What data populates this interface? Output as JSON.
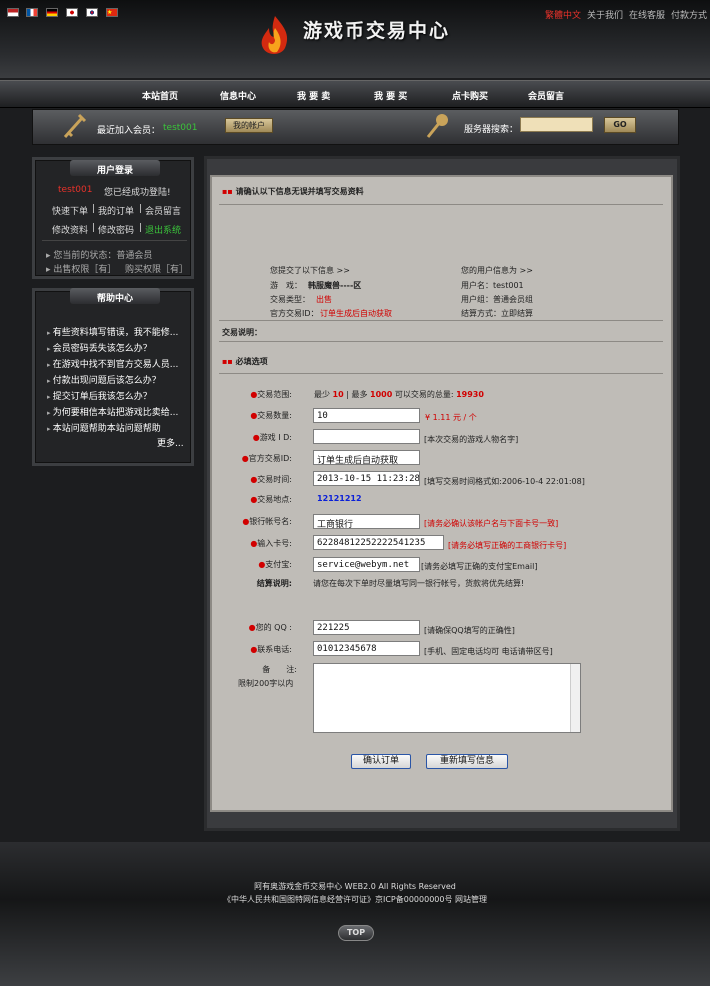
{
  "topbar": {
    "links": [
      "繁體中文",
      "关于我们",
      "在线客服",
      "付款方式"
    ],
    "title": "游戏币交易中心"
  },
  "nav": [
    "本站首页",
    "信息中心",
    "我 要 卖",
    "我 要 买",
    "点卡购买",
    "会员留言"
  ],
  "infobar": {
    "recent_label": "最近加入会员：",
    "recent_user": "test001",
    "account_btn": "我的帐户",
    "search_label": "服务器搜索：",
    "go_btn": "GO"
  },
  "login_panel": {
    "title": "用户登录",
    "username": "test001",
    "welcome": "您已经成功登陆!",
    "row1": [
      "快速下单",
      "我的订单",
      "会员留言"
    ],
    "row2": [
      "修改资料",
      "修改密码",
      "退出系统"
    ],
    "status": "您当前的状态：普通会员",
    "perm_sell": "出售权限［有］",
    "perm_buy": "购买权限［有］"
  },
  "help_panel": {
    "title": "帮助中心",
    "items": [
      "有些资料填写错误，我不能修...",
      "会员密码丢失该怎么办？",
      "在游戏中找不到官方交易人员...",
      "付款出现问题后该怎么办？",
      "提交订单后我该怎么办？",
      "为何要相信本站把游戏比卖给...",
      "本站问题帮助本站问题帮助"
    ],
    "more": "更多..."
  },
  "main": {
    "heading": "请确认以下信息无误并填写交易资料",
    "submitted_label": "您提交了以下信息 >>",
    "user_info_label": "您的用户信息为 >>",
    "game_label": "游　戏：",
    "game_value": "韩服魔兽----区",
    "trade_type_label": "交易类型：",
    "trade_type_value": "出售",
    "trade_id_label": "官方交易ID：",
    "trade_id_value": "订单生成后自动获取",
    "username_line": "用户名：test001",
    "group_line": "用户组：普通会员组",
    "settle_line": "结算方式：立即结算",
    "desc_label": "交易说明：",
    "required_label": "必填选项",
    "range_label": "交易范围:",
    "range_text": {
      "a": "最少",
      "min": "10",
      "b": "| 最多",
      "max": "1000",
      "c": "可以交易的总量:",
      "total": "19930"
    },
    "qty_label": "交易数量:",
    "qty_value": "10",
    "price": "¥ 1.11 元 / 个",
    "role_label": "游戏 I D:",
    "role_value": "",
    "role_hint": "[本次交易的游戏人物名字]",
    "off_id_label": "官方交易ID:",
    "off_id_value": "订单生成后自动获取",
    "time_label": "交易时间:",
    "time_value": "2013-10-15 11:23:28",
    "time_hint": "[填写交易时间格式如:2006-10-4 22:01:08]",
    "place_label": "交易地点:",
    "place_value": "12121212",
    "bank_label": "银行帐号名:",
    "bank_value": "工商银行",
    "bank_hint": "[请务必确认该帐户名与下面卡号一致]",
    "card_label": "输入卡号:",
    "card_value": "62284812252222541235",
    "card_hint": "[请务必填写正确的工商银行卡号]",
    "alipay_label": "支付宝:",
    "alipay_value": "service@webym.net",
    "alipay_hint": "[请务必填写正确的支付宝Email]",
    "settle_label": "结算说明:",
    "settle_text": "请您在每次下单时尽量填写同一银行帐号，货款将优先结算!",
    "qq_label": "您的 QQ :",
    "qq_value": "221225",
    "qq_hint": "[请确保QQ填写的正确性]",
    "phone_label": "联系电话:",
    "phone_value": "01012345678",
    "phone_hint": "[手机、固定电话均可 电话请带区号]",
    "note_label": "备　　注:",
    "note_limit": "限制200字以内",
    "confirm_btn": "确认订单",
    "reset_btn": "重新填写信息"
  },
  "footer": {
    "line1": "阿有奥游戏金币交易中心 WEB2.0 All Rights Reserved",
    "line2": "《中华人民共和国图特网信息经营许可证》京ICP备00000000号 网站管理",
    "top": "TOP"
  },
  "colors": {
    "accent_red": "#d10000",
    "blue": "#0a1fd8",
    "green": "#3bc43b"
  }
}
